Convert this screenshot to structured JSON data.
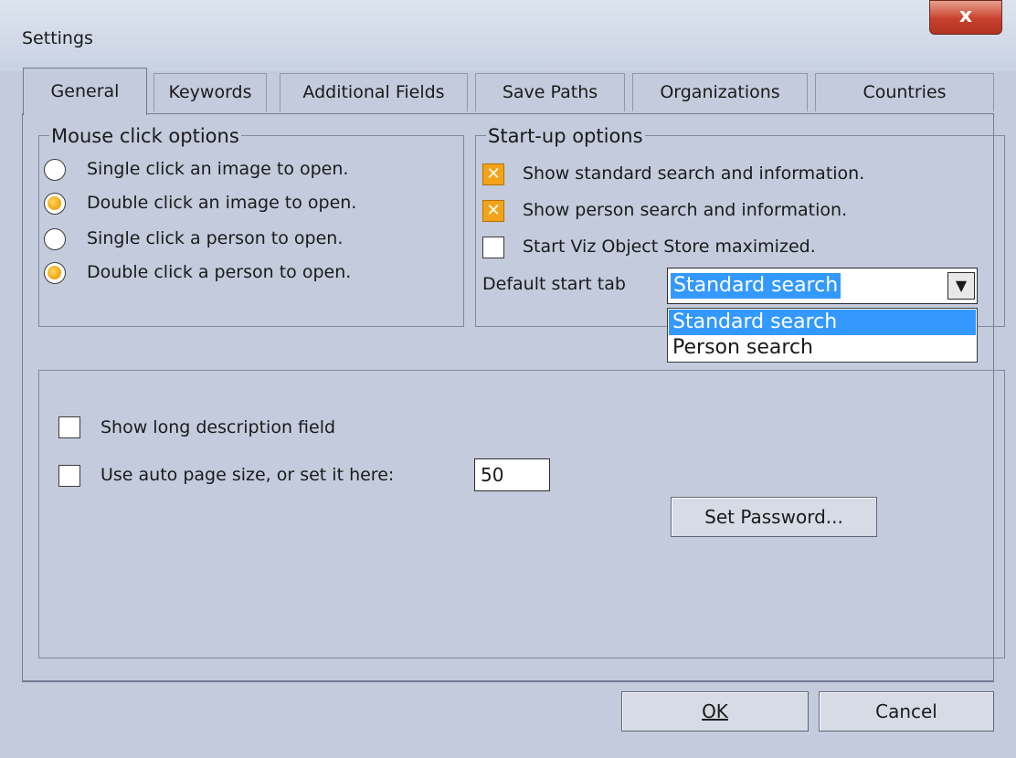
{
  "window": {
    "title": "Settings",
    "close_label": "x"
  },
  "tabs": [
    {
      "label": "General"
    },
    {
      "label": "Keywords"
    },
    {
      "label": "Additional Fields"
    },
    {
      "label": "Save Paths"
    },
    {
      "label": "Organizations"
    },
    {
      "label": "Countries"
    }
  ],
  "mouse_click": {
    "legend": "Mouse click options",
    "options": [
      {
        "label": "Single click an image to open.",
        "checked": false
      },
      {
        "label": "Double click an image to open.",
        "checked": true
      },
      {
        "label": "Single click a person to open.",
        "checked": false
      },
      {
        "label": "Double click a person to open.",
        "checked": true
      }
    ]
  },
  "startup": {
    "legend": "Start-up options",
    "options": [
      {
        "label": "Show standard search and information.",
        "checked": true
      },
      {
        "label": "Show person search and information.",
        "checked": true
      },
      {
        "label": "Start Viz Object Store maximized.",
        "checked": false
      }
    ],
    "default_tab_label": "Default start tab",
    "default_tab_value": "Standard search",
    "dropdown_options": [
      "Standard search",
      "Person search"
    ]
  },
  "misc": {
    "long_description_label": "Show long description field",
    "auto_page_label": "Use auto page size, or set it here:",
    "page_size_value": "50",
    "set_password_label": "Set Password..."
  },
  "footer": {
    "ok_label": "OK",
    "cancel_label": "Cancel"
  },
  "colors": {
    "accent_orange": "#f0a500",
    "selection_blue": "#3399ff",
    "dialog_bg": "#c3cbdd"
  },
  "icons": {
    "close": "close-icon",
    "dropdown": "chevron-down-icon"
  }
}
